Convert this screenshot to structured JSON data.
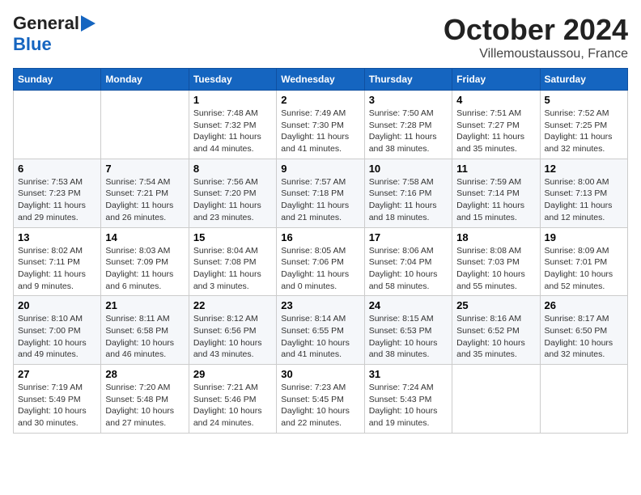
{
  "header": {
    "logo_line1": "General",
    "logo_line2": "Blue",
    "month": "October 2024",
    "location": "Villemoustaussou, France"
  },
  "weekdays": [
    "Sunday",
    "Monday",
    "Tuesday",
    "Wednesday",
    "Thursday",
    "Friday",
    "Saturday"
  ],
  "weeks": [
    [
      {
        "day": "",
        "detail": ""
      },
      {
        "day": "",
        "detail": ""
      },
      {
        "day": "1",
        "detail": "Sunrise: 7:48 AM\nSunset: 7:32 PM\nDaylight: 11 hours and 44 minutes."
      },
      {
        "day": "2",
        "detail": "Sunrise: 7:49 AM\nSunset: 7:30 PM\nDaylight: 11 hours and 41 minutes."
      },
      {
        "day": "3",
        "detail": "Sunrise: 7:50 AM\nSunset: 7:28 PM\nDaylight: 11 hours and 38 minutes."
      },
      {
        "day": "4",
        "detail": "Sunrise: 7:51 AM\nSunset: 7:27 PM\nDaylight: 11 hours and 35 minutes."
      },
      {
        "day": "5",
        "detail": "Sunrise: 7:52 AM\nSunset: 7:25 PM\nDaylight: 11 hours and 32 minutes."
      }
    ],
    [
      {
        "day": "6",
        "detail": "Sunrise: 7:53 AM\nSunset: 7:23 PM\nDaylight: 11 hours and 29 minutes."
      },
      {
        "day": "7",
        "detail": "Sunrise: 7:54 AM\nSunset: 7:21 PM\nDaylight: 11 hours and 26 minutes."
      },
      {
        "day": "8",
        "detail": "Sunrise: 7:56 AM\nSunset: 7:20 PM\nDaylight: 11 hours and 23 minutes."
      },
      {
        "day": "9",
        "detail": "Sunrise: 7:57 AM\nSunset: 7:18 PM\nDaylight: 11 hours and 21 minutes."
      },
      {
        "day": "10",
        "detail": "Sunrise: 7:58 AM\nSunset: 7:16 PM\nDaylight: 11 hours and 18 minutes."
      },
      {
        "day": "11",
        "detail": "Sunrise: 7:59 AM\nSunset: 7:14 PM\nDaylight: 11 hours and 15 minutes."
      },
      {
        "day": "12",
        "detail": "Sunrise: 8:00 AM\nSunset: 7:13 PM\nDaylight: 11 hours and 12 minutes."
      }
    ],
    [
      {
        "day": "13",
        "detail": "Sunrise: 8:02 AM\nSunset: 7:11 PM\nDaylight: 11 hours and 9 minutes."
      },
      {
        "day": "14",
        "detail": "Sunrise: 8:03 AM\nSunset: 7:09 PM\nDaylight: 11 hours and 6 minutes."
      },
      {
        "day": "15",
        "detail": "Sunrise: 8:04 AM\nSunset: 7:08 PM\nDaylight: 11 hours and 3 minutes."
      },
      {
        "day": "16",
        "detail": "Sunrise: 8:05 AM\nSunset: 7:06 PM\nDaylight: 11 hours and 0 minutes."
      },
      {
        "day": "17",
        "detail": "Sunrise: 8:06 AM\nSunset: 7:04 PM\nDaylight: 10 hours and 58 minutes."
      },
      {
        "day": "18",
        "detail": "Sunrise: 8:08 AM\nSunset: 7:03 PM\nDaylight: 10 hours and 55 minutes."
      },
      {
        "day": "19",
        "detail": "Sunrise: 8:09 AM\nSunset: 7:01 PM\nDaylight: 10 hours and 52 minutes."
      }
    ],
    [
      {
        "day": "20",
        "detail": "Sunrise: 8:10 AM\nSunset: 7:00 PM\nDaylight: 10 hours and 49 minutes."
      },
      {
        "day": "21",
        "detail": "Sunrise: 8:11 AM\nSunset: 6:58 PM\nDaylight: 10 hours and 46 minutes."
      },
      {
        "day": "22",
        "detail": "Sunrise: 8:12 AM\nSunset: 6:56 PM\nDaylight: 10 hours and 43 minutes."
      },
      {
        "day": "23",
        "detail": "Sunrise: 8:14 AM\nSunset: 6:55 PM\nDaylight: 10 hours and 41 minutes."
      },
      {
        "day": "24",
        "detail": "Sunrise: 8:15 AM\nSunset: 6:53 PM\nDaylight: 10 hours and 38 minutes."
      },
      {
        "day": "25",
        "detail": "Sunrise: 8:16 AM\nSunset: 6:52 PM\nDaylight: 10 hours and 35 minutes."
      },
      {
        "day": "26",
        "detail": "Sunrise: 8:17 AM\nSunset: 6:50 PM\nDaylight: 10 hours and 32 minutes."
      }
    ],
    [
      {
        "day": "27",
        "detail": "Sunrise: 7:19 AM\nSunset: 5:49 PM\nDaylight: 10 hours and 30 minutes."
      },
      {
        "day": "28",
        "detail": "Sunrise: 7:20 AM\nSunset: 5:48 PM\nDaylight: 10 hours and 27 minutes."
      },
      {
        "day": "29",
        "detail": "Sunrise: 7:21 AM\nSunset: 5:46 PM\nDaylight: 10 hours and 24 minutes."
      },
      {
        "day": "30",
        "detail": "Sunrise: 7:23 AM\nSunset: 5:45 PM\nDaylight: 10 hours and 22 minutes."
      },
      {
        "day": "31",
        "detail": "Sunrise: 7:24 AM\nSunset: 5:43 PM\nDaylight: 10 hours and 19 minutes."
      },
      {
        "day": "",
        "detail": ""
      },
      {
        "day": "",
        "detail": ""
      }
    ]
  ]
}
